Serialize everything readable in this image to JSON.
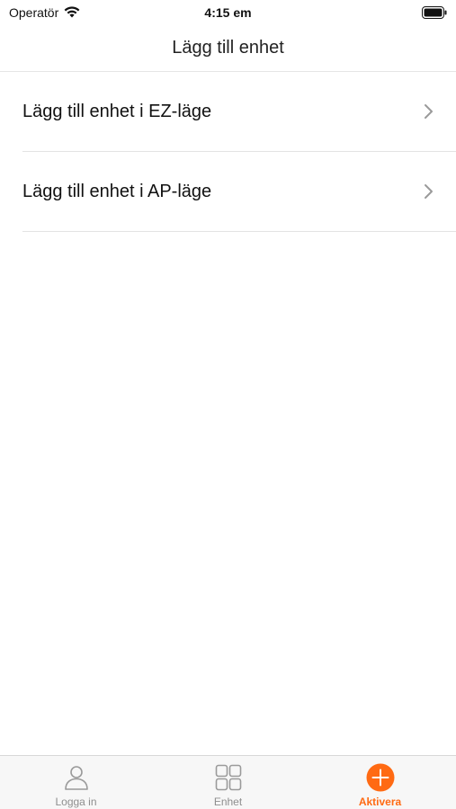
{
  "status_bar": {
    "carrier": "Operatör",
    "time": "4:15 em"
  },
  "nav": {
    "title": "Lägg till enhet"
  },
  "list": {
    "items": [
      {
        "label": "Lägg till enhet i EZ-läge"
      },
      {
        "label": "Lägg till enhet i AP-läge"
      }
    ]
  },
  "tab_bar": {
    "accent_color": "#ff6a13",
    "inactive_color": "#8e8e8e",
    "tabs": [
      {
        "label": "Logga in",
        "icon": "person-icon",
        "active": false
      },
      {
        "label": "Enhet",
        "icon": "grid-icon",
        "active": false
      },
      {
        "label": "Aktivera",
        "icon": "plus-circle-icon",
        "active": true
      }
    ]
  }
}
